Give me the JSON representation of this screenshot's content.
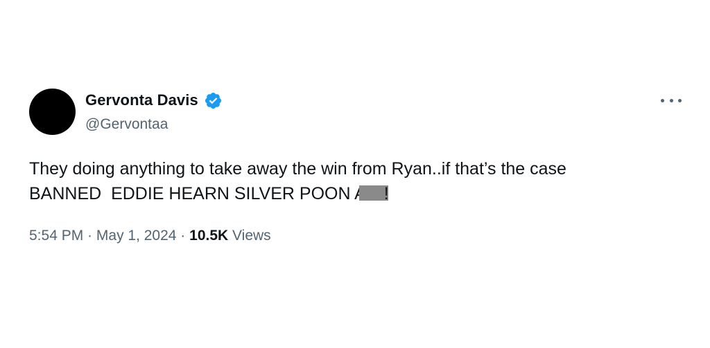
{
  "author": {
    "display_name": "Gervonta Davis",
    "handle": "@Gervontaa",
    "verified": true,
    "verified_color": "#1d9bf0",
    "avatar_color": "#000000"
  },
  "tweet": {
    "line1": "They doing anything to take away the win from Ryan..if that’s the case",
    "line2_before": "BANNED  EDDIE HEARN SILVER POON A",
    "line2_after": "!"
  },
  "meta": {
    "time": "5:54 PM",
    "separator": " · ",
    "date": "May 1, 2024",
    "views_count": "10.5K",
    "views_label": " Views"
  },
  "icons": {
    "more": "more-options-icon",
    "verified": "verified-badge-icon"
  }
}
